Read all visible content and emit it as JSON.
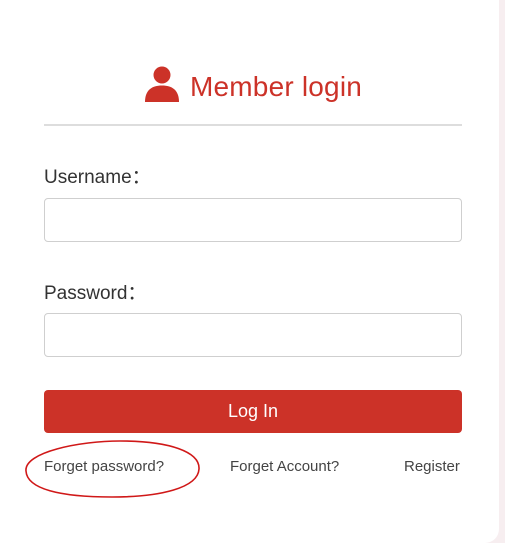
{
  "login": {
    "title": "Member login",
    "username_label": "Username：",
    "username_value": "",
    "password_label": "Password：",
    "password_value": "",
    "login_button": "Log In",
    "forget_password_link": "Forget password?",
    "forget_account_link": "Forget Account?",
    "register_link": "Register"
  },
  "icons": {
    "header_icon": "user-icon"
  },
  "colors": {
    "accent": "#cc3228",
    "annotation": "#d01818",
    "divider": "#dddddd",
    "text": "#333333"
  }
}
